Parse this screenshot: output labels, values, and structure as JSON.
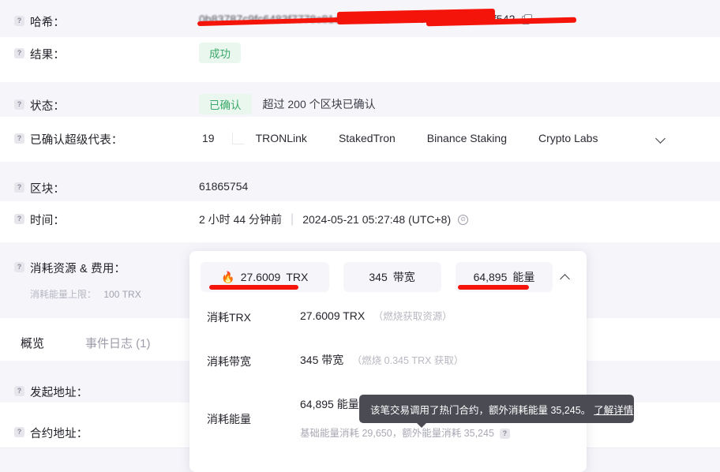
{
  "rows": {
    "hash": {
      "label": "哈希：",
      "value_blurred": "0b83787c9fc6483f7778c81eee61735e",
      "value_tail": "f543c5ad2c668ab21f542",
      "copy_icon": "copy-icon"
    },
    "result": {
      "label": "结果：",
      "badge": "成功"
    },
    "status": {
      "label": "状态：",
      "badge": "已确认",
      "note": "超过 200 个区块已确认"
    },
    "sr": {
      "label": "已确认超级代表：",
      "count": "19",
      "names": [
        "TRONLink",
        "StakedTron",
        "Binance Staking",
        "Crypto Labs"
      ],
      "expand_icon": "chevron-down-icon"
    },
    "block": {
      "label": "区块：",
      "value": "61865754"
    },
    "time": {
      "label": "时间：",
      "relative": "2 小时 44 分钟前",
      "divider": "|",
      "absolute": "2024-05-21 05:27:48 (UTC+8)",
      "clock_icon": "clock-icon"
    },
    "resource": {
      "label": "消耗资源 & 费用：",
      "sub_label": "消耗能量上限：",
      "sub_value": "100 TRX"
    },
    "from": {
      "label": "发起地址："
    },
    "contract": {
      "label": "合约地址："
    }
  },
  "resource_card": {
    "tabs": [
      {
        "icon": "flame-icon",
        "glyph": "🔥",
        "value": "27.6009",
        "unit": "TRX",
        "underlined": true
      },
      {
        "icon": "",
        "glyph": "",
        "value": "345",
        "unit": "带宽",
        "underlined": false
      },
      {
        "icon": "",
        "glyph": "",
        "value": "64,895",
        "unit": "能量",
        "underlined": true
      }
    ],
    "collapse_icon": "chevron-up-icon",
    "details": [
      {
        "key": "消耗TRX",
        "value": "27.6009 TRX",
        "note": "（燃烧获取资源）"
      },
      {
        "key": "消耗带宽",
        "value": "345 带宽",
        "note": "（燃烧 0.345 TRX 获取）"
      },
      {
        "key": "消耗能量",
        "value": "64,895 能量",
        "note": ""
      }
    ],
    "energy_breakdown": "基础能量消耗 29,650，额外能量消耗 35,245",
    "energy_help_icon": "help-icon"
  },
  "tooltip": {
    "text": "该笔交易调用了热门合约，额外消耗能量 35,245。",
    "link": "了解详情"
  },
  "page_tabs": [
    {
      "label": "概览",
      "active": true
    },
    {
      "label": "事件日志 (1)",
      "active": false
    }
  ],
  "icons": {
    "help": "?",
    "clock": "🕐"
  },
  "colors": {
    "accent_green": "#3aa86a",
    "badge_bg": "#e9f7ee",
    "redaction_red": "#f5140a",
    "stripe_bg": "#f5f5fa",
    "tooltip_bg": "#4b4b54"
  }
}
